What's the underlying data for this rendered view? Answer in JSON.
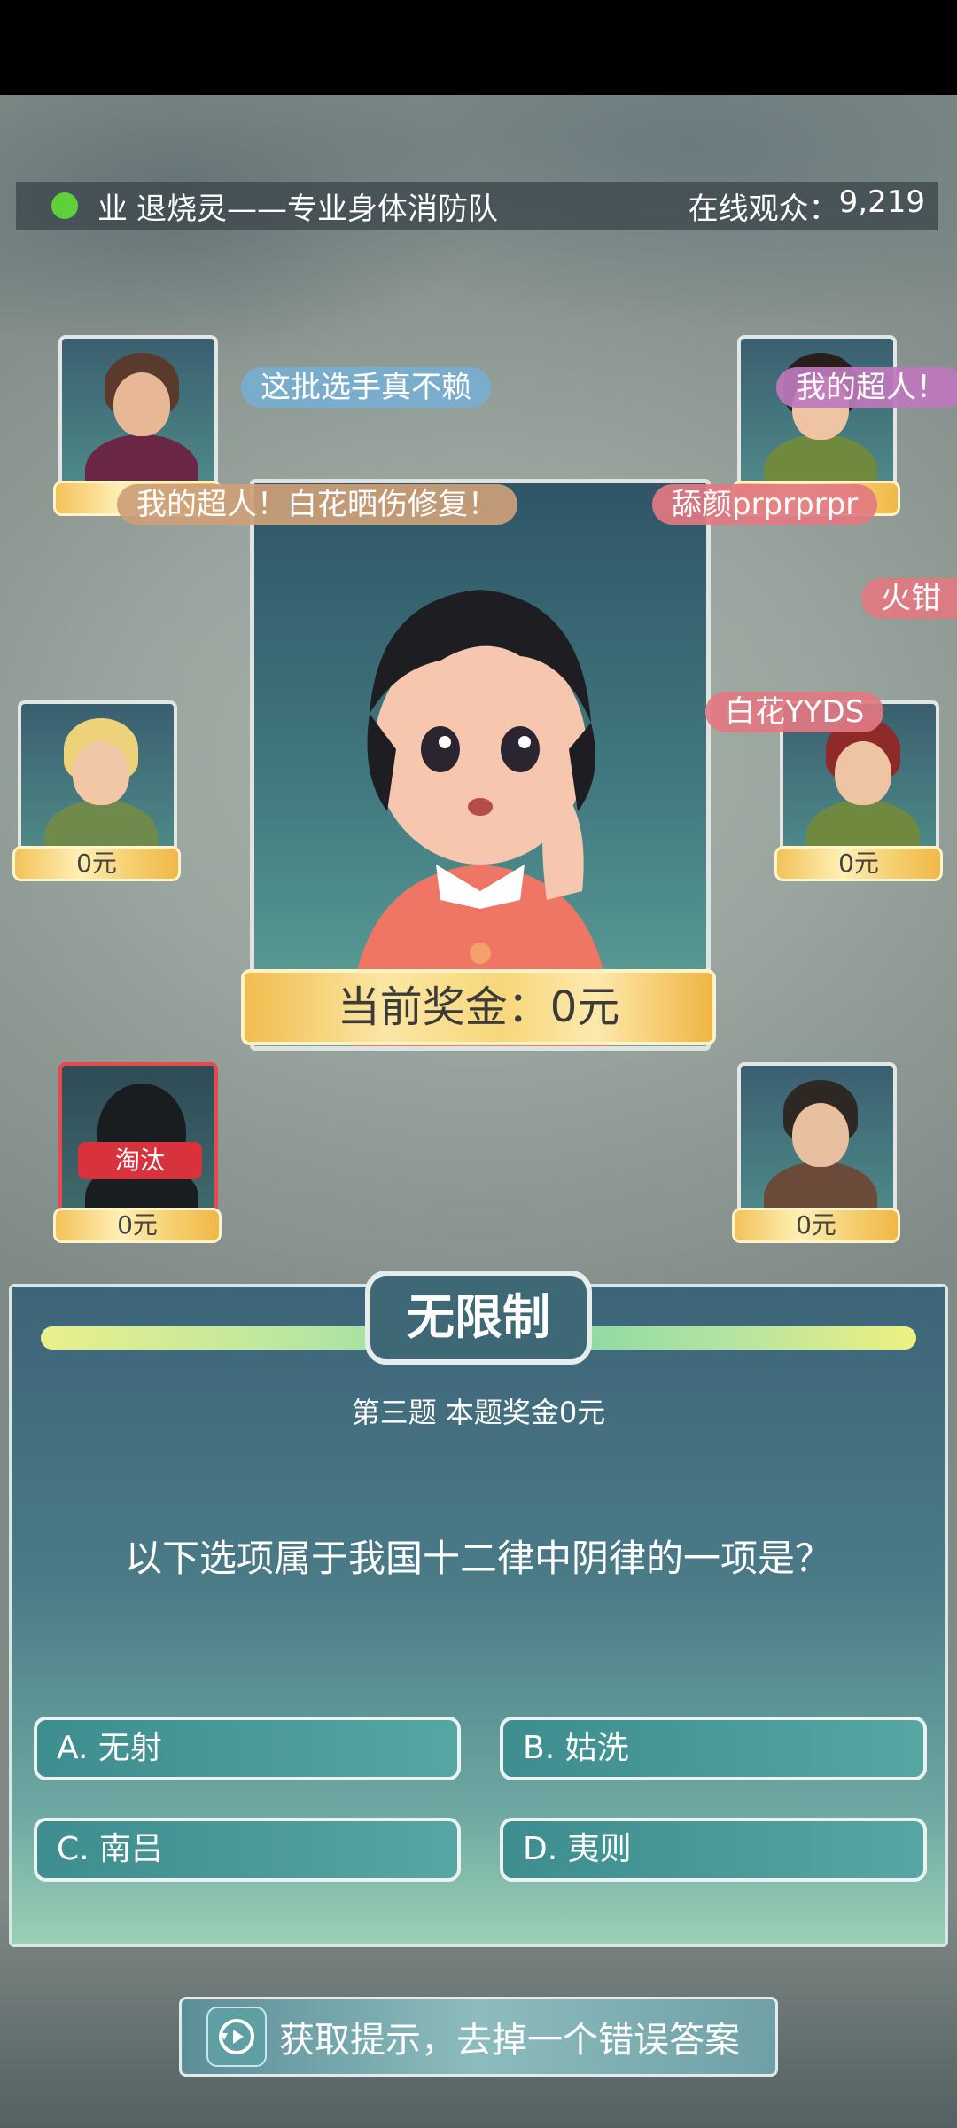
{
  "header": {
    "host_icon": "业",
    "host_name": "退烧灵——专业身体消防队",
    "viewers_label": "在线观众：",
    "viewers_count": "9,219"
  },
  "players": [
    {
      "prize": "",
      "status": ""
    },
    {
      "prize": "",
      "status": ""
    },
    {
      "prize": "0元",
      "status": ""
    },
    {
      "prize": "0元",
      "status": ""
    },
    {
      "prize": "0元",
      "status": "淘汰"
    },
    {
      "prize": "0元",
      "status": ""
    }
  ],
  "chat": [
    "这批选手真不赖",
    "我的超人！",
    "我的超人！白花晒伤修复！",
    "舔颜prprprpr",
    "火钳",
    "白花YYDS"
  ],
  "contestant": {
    "current_prize": "当前奖金：0元"
  },
  "question": {
    "mode": "无限制",
    "meta": "第三题 本题奖金0元",
    "text": "以下选项属于我国十二律中阴律的一项是？",
    "options": [
      "A. 无射",
      "B. 姑洗",
      "C. 南吕",
      "D. 夷则"
    ]
  },
  "hint": {
    "label": "获取提示，去掉一个错误答案",
    "icon": "play-replay-icon"
  },
  "colors": {
    "live_dot": "#5fd03a",
    "eliminated": "#d8323d",
    "gold": "#f2bd4f"
  }
}
